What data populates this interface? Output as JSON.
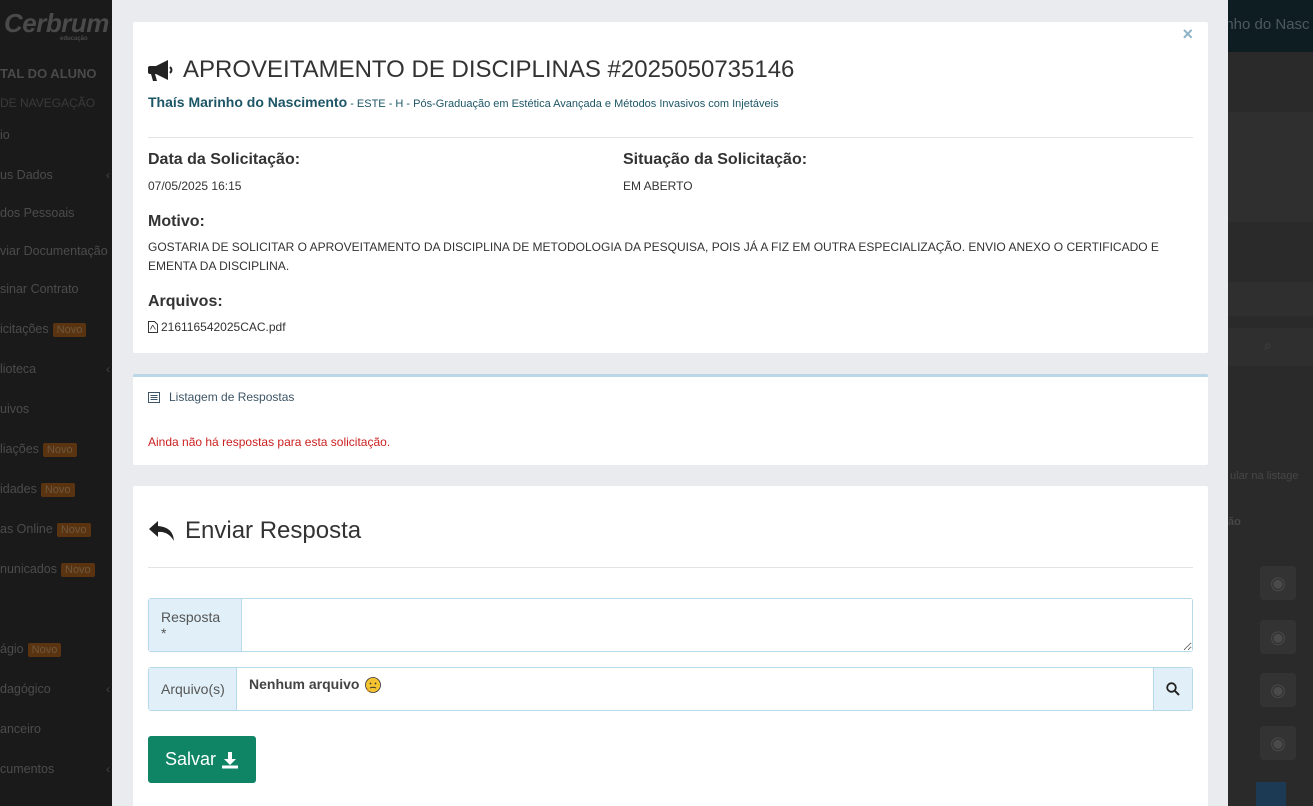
{
  "background": {
    "brand": "Cerbrum",
    "brand_sub": "educação",
    "portal_title": "TAL DO ALUNO",
    "nav_title": "DE NAVEGAÇÃO",
    "sidebar_items": [
      {
        "label": "io",
        "badge": ""
      },
      {
        "label": "us Dados",
        "badge": ""
      },
      {
        "label": "dos Pessoais",
        "badge": ""
      },
      {
        "label": "viar Documentação",
        "badge": ""
      },
      {
        "label": "sinar Contrato",
        "badge": ""
      },
      {
        "label": "icitações",
        "badge": "Novo"
      },
      {
        "label": "lioteca",
        "badge": ""
      },
      {
        "label": "uivos",
        "badge": ""
      },
      {
        "label": "liações",
        "badge": "Novo"
      },
      {
        "label": "idades",
        "badge": "Novo"
      },
      {
        "label": "as Online",
        "badge": "Novo"
      },
      {
        "label": "nunicados",
        "badge": "Novo"
      },
      {
        "label": "ágio",
        "badge": "Novo"
      },
      {
        "label": "dagógico",
        "badge": ""
      },
      {
        "label": "anceiro",
        "badge": ""
      },
      {
        "label": "cumentos",
        "badge": ""
      }
    ],
    "topbar_name": "inho do Nasc",
    "list_hint": "ular na listage",
    "col_header": "ão"
  },
  "modal": {
    "close": "×",
    "title": "APROVEITAMENTO DE DISCIPLINAS #2025050735146",
    "student_name": "Thaís Marinho do Nascimento",
    "course": " - ESTE - H - Pós-Graduação em Estética Avançada e Métodos Invasivos com Injetáveis",
    "date_label": "Data da Solicitação:",
    "date_value": "07/05/2025 16:15",
    "status_label": "Situação da Solicitação:",
    "status_value": "EM ABERTO",
    "reason_label": "Motivo:",
    "reason_value": "GOSTARIA DE SOLICITAR O APROVEITAMENTO DA DISCIPLINA DE METODOLOGIA DA PESQUISA, POIS JÁ A FIZ EM OUTRA ESPECIALIZAÇÃO. ENVIO ANEXO O CERTIFICADO E EMENTA DA DISCIPLINA.",
    "files_label": "Arquivos:",
    "file_name": "216116542025CAC.pdf"
  },
  "responses": {
    "header": "Listagem de Respostas",
    "empty_message": "Ainda não há respostas para esta solicitação."
  },
  "form": {
    "title": "Enviar Resposta",
    "response_label": "Resposta *",
    "response_value": "",
    "files_label": "Arquivo(s)",
    "files_value": "Nenhum arquivo",
    "save_label": "Salvar"
  },
  "colors": {
    "primary_button": "#0f8566",
    "student_name": "#1d5666",
    "error_text": "#cc1f1f",
    "addon_bg": "#e1f0f8",
    "badge": "#5a3410"
  },
  "icons": [
    "megaphone-icon",
    "pdf-icon",
    "list-icon",
    "reply-icon",
    "confused-emoji-icon",
    "search-icon",
    "download-icon",
    "close-icon",
    "eye-icon"
  ]
}
